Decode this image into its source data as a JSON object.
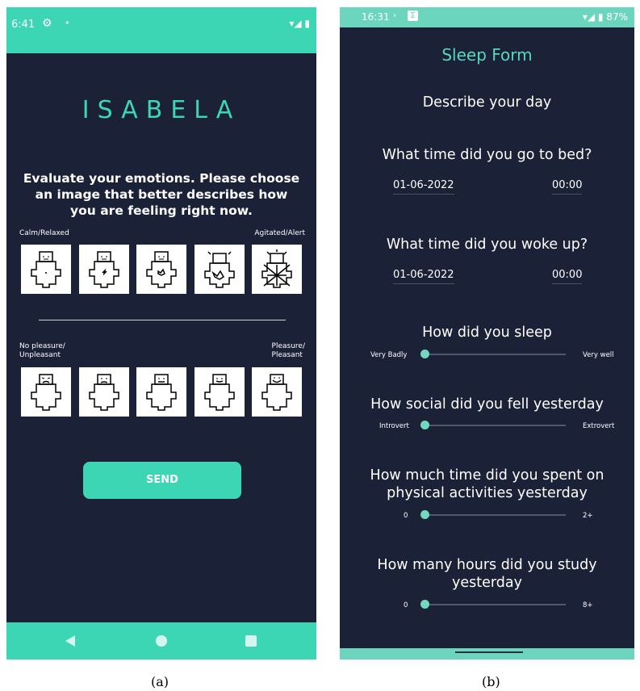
{
  "panel_a": {
    "status_time": "6:41",
    "logo": "ISABELA",
    "prompt": "Evaluate your emotions. Please choose an image that better describes how you are feeling right now.",
    "arousal": {
      "left_label": "Calm/Relaxed",
      "right_label": "Agitated/Alert"
    },
    "valence": {
      "left_label_1": "No pleasure/",
      "left_label_2": "Unpleasant",
      "right_label_1": "Pleasure/",
      "right_label_2": "Pleasant"
    },
    "send_label": "SEND"
  },
  "panel_b": {
    "status_time": "16:31",
    "battery": "87%",
    "title": "Sleep Form",
    "subtitle": "Describe your day",
    "bed_question": "What time did you go to bed?",
    "bed_date": "01-06-2022",
    "bed_time": "00:00",
    "wake_question": "What time did you woke up?",
    "wake_date": "01-06-2022",
    "wake_time": "00:00",
    "sliders": [
      {
        "question": "How did you sleep",
        "min_label": "Very Badly",
        "max_label": "Very well",
        "value": 0
      },
      {
        "question": "How social did you fell yesterday",
        "min_label": "Introvert",
        "max_label": "Extrovert",
        "value": 0
      },
      {
        "question_1": "How much time did you spent on",
        "question_2": "physical activities yesterday",
        "min_label": "0",
        "max_label": "2+",
        "value": 0
      },
      {
        "question_1": "How many hours did you study",
        "question_2": "yesterday",
        "min_label": "0",
        "max_label": "8+",
        "value": 0
      }
    ]
  },
  "captions": {
    "a": "(a)",
    "b": "(b)"
  },
  "colors": {
    "accent": "#3dd6b5",
    "background": "#1b2137",
    "title_b": "#58d7bd"
  }
}
